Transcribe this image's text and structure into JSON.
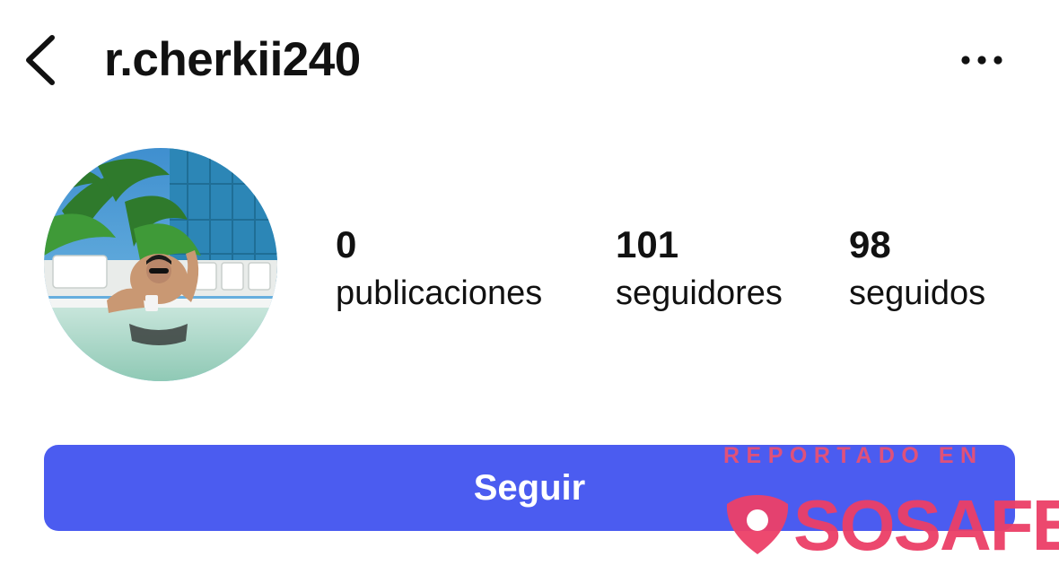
{
  "header": {
    "back_icon": "chevron-left-icon",
    "username": "r.cherkii240",
    "more_icon": "more-horizontal-icon"
  },
  "profile": {
    "avatar_alt": "profile-photo"
  },
  "stats": {
    "posts": {
      "count": "0",
      "label": "publicaciones"
    },
    "followers": {
      "count": "101",
      "label": "seguidores"
    },
    "following": {
      "count": "98",
      "label": "seguidos"
    }
  },
  "actions": {
    "follow_label": "Seguir",
    "follow_color": "#4b5cf0"
  },
  "watermark": {
    "caption": "REPORTADO EN",
    "brand": "SOSAFE",
    "color": "#ec3f67"
  }
}
